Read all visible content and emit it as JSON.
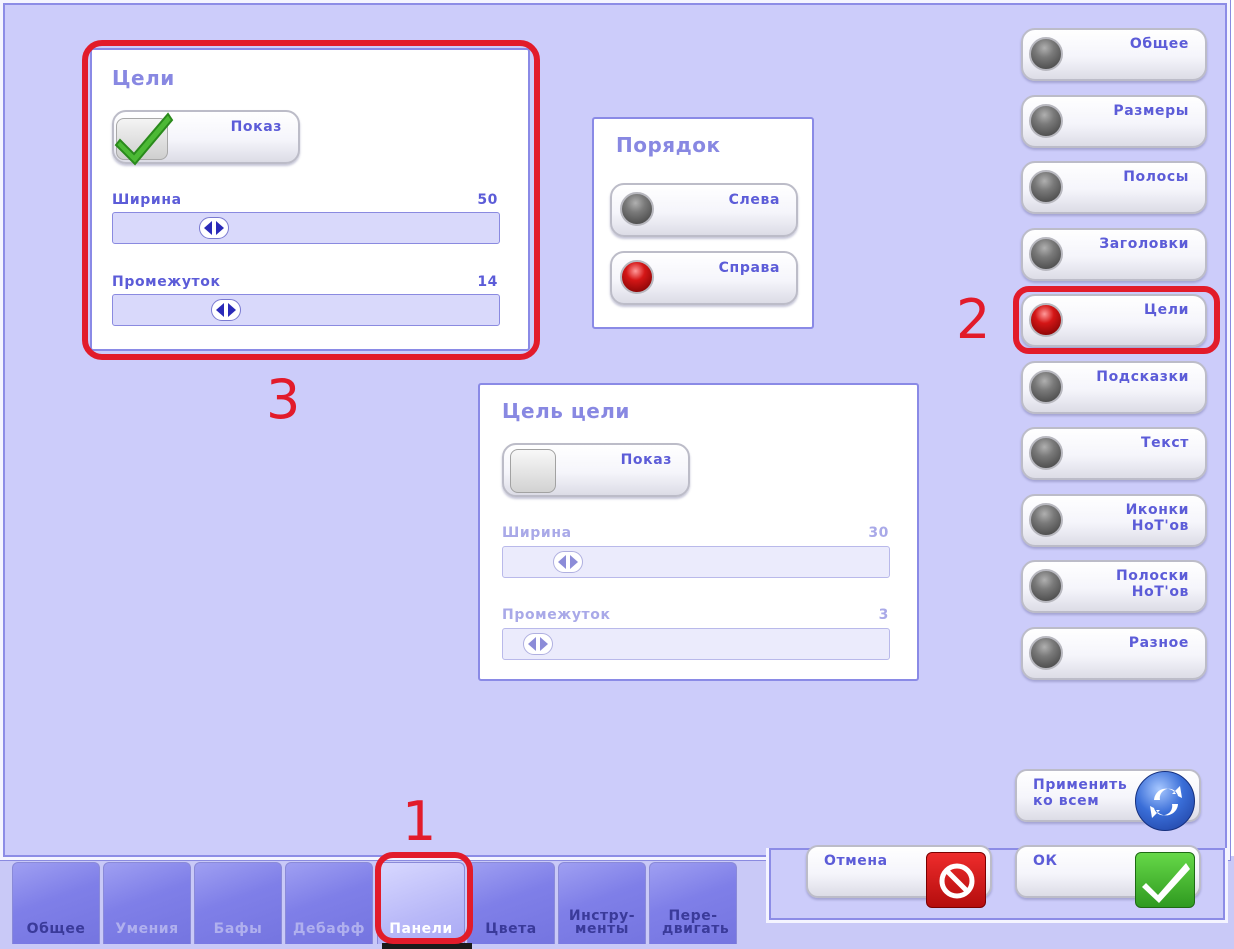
{
  "targets_panel": {
    "title": "Цели",
    "show_label": "Показ",
    "show_checked": true,
    "width_label": "Ширина",
    "width_value": "50",
    "gap_label": "Промежуток",
    "gap_value": "14"
  },
  "order_panel": {
    "title": "Порядок",
    "left_label": "Слева",
    "right_label": "Справа",
    "selected": "right"
  },
  "target_of_target_panel": {
    "title": "Цель цели",
    "show_label": "Показ",
    "show_checked": false,
    "width_label": "Ширина",
    "width_value": "30",
    "gap_label": "Промежуток",
    "gap_value": "3"
  },
  "sidebar": {
    "items": [
      {
        "label": "Общее",
        "selected": false
      },
      {
        "label": "Размеры",
        "selected": false
      },
      {
        "label": "Полосы",
        "selected": false
      },
      {
        "label": "Заголовки",
        "selected": false
      },
      {
        "label": "Цели",
        "selected": true
      },
      {
        "label": "Подсказки",
        "selected": false
      },
      {
        "label": "Текст",
        "selected": false
      },
      {
        "label": "Иконки НоТ'ов",
        "selected": false
      },
      {
        "label": "Полоски НоТ'ов",
        "selected": false
      },
      {
        "label": "Разное",
        "selected": false
      }
    ]
  },
  "actions": {
    "apply_all_label": "Применить ко всем",
    "cancel_label": "Отмена",
    "ok_label": "ОК"
  },
  "tabs": [
    {
      "label": "Общее",
      "active": false
    },
    {
      "label": "Умения",
      "active": false
    },
    {
      "label": "Бафы",
      "active": false
    },
    {
      "label": "Дебафф",
      "active": false
    },
    {
      "label": "Панели",
      "active": true
    },
    {
      "label": "Цвета",
      "active": false
    },
    {
      "label": "Инстру-менты",
      "active": false
    },
    {
      "label": "Пере-двигать",
      "active": false
    }
  ],
  "annotations": {
    "one": "1",
    "two": "2",
    "three": "3"
  },
  "colors": {
    "accent": "#5c5cd8",
    "annotation_red": "#e21b2a",
    "window_bg": "#ccccfa"
  }
}
